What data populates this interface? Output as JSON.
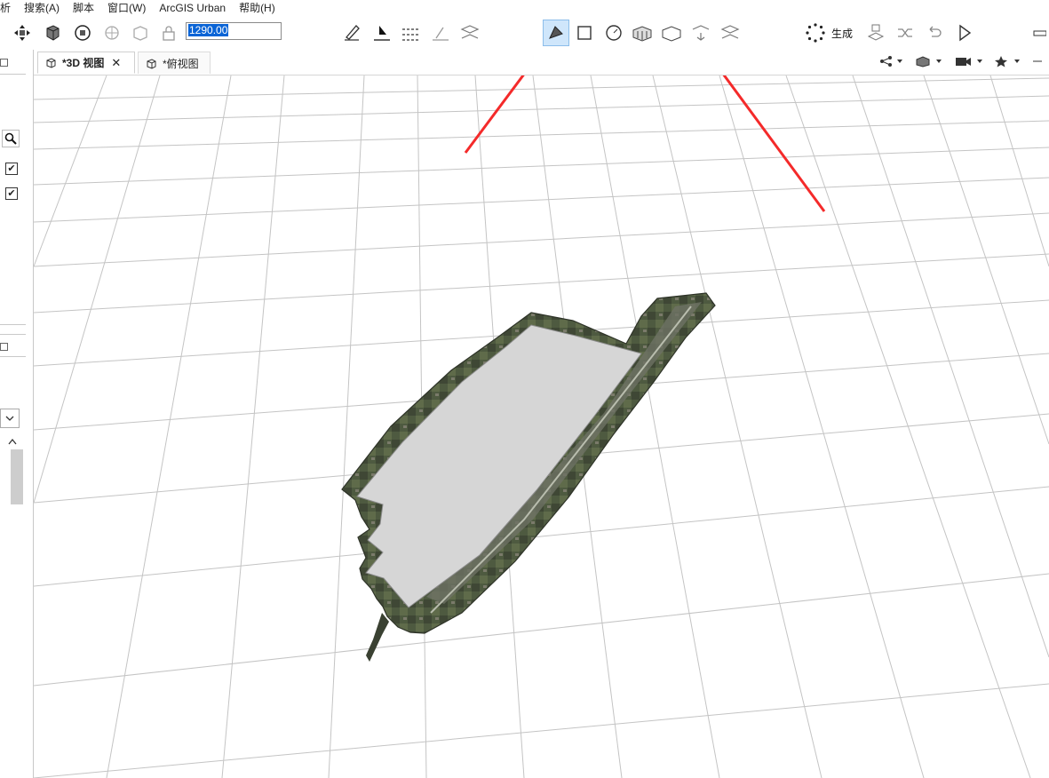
{
  "menu": [
    "析",
    "搜索(A)",
    "脚本",
    "窗口(W)",
    "ArcGIS Urban",
    "帮助(H)"
  ],
  "toolbar": {
    "zoom_value": "1290.00",
    "generate_label": "生成",
    "icons": {
      "navigate": "navigate-icon",
      "frame": "frame-icon",
      "orbit": "orbit-icon",
      "globe": "globe-icon",
      "map": "map-icon",
      "lock": "lock-icon",
      "draw_polygon_active": "polygon-draw-icon"
    }
  },
  "tabs": [
    {
      "label": "*3D 视图",
      "active": true
    },
    {
      "label": "*俯视图",
      "active": false
    }
  ],
  "left_panel": {
    "checkbox_1_checked": true,
    "checkbox_2_checked": true
  },
  "colors": {
    "accent_active": "#cfe6fb",
    "arrow": "#f42a2a",
    "selection": "#0a64d6",
    "model_fill": "#d6d6d6",
    "grid": "#c4c4c4"
  }
}
